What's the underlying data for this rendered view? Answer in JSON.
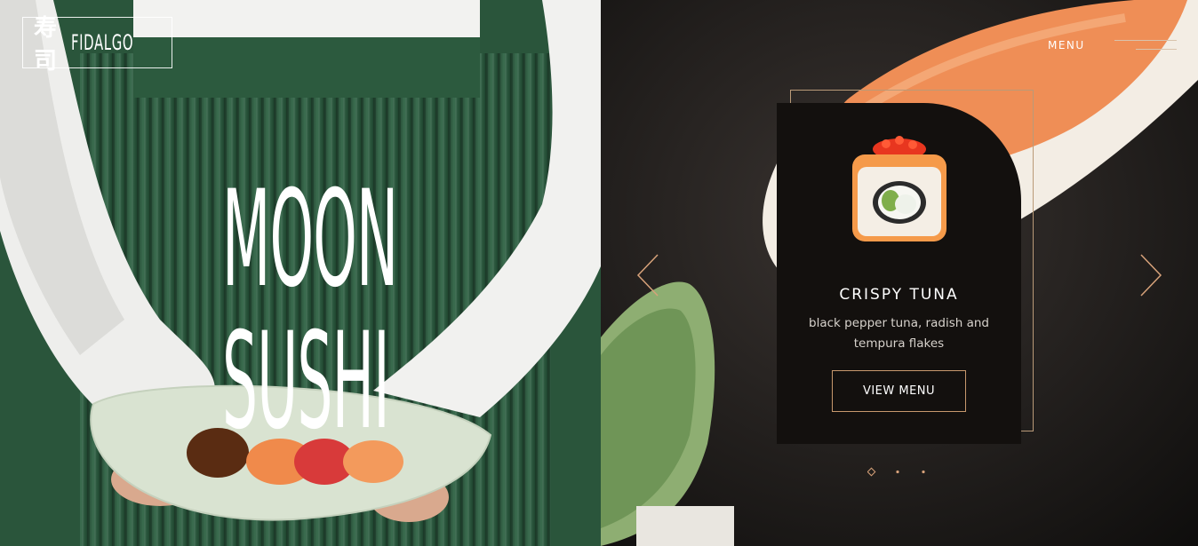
{
  "logo": {
    "kanji": "寿司",
    "brand": "FIDALGO"
  },
  "hero": {
    "line1": "MOON",
    "line2": "SUSHI"
  },
  "nav": {
    "menu_label": "MENU"
  },
  "card": {
    "title": "CRISPY TUNA",
    "description": "black pepper tuna, radish and tempura flakes",
    "button_label": "VIEW MENU"
  },
  "slider": {
    "slide_count": 3,
    "active_slide": 1
  },
  "colors": {
    "accent": "#c7986d",
    "card_bg": "#13100e",
    "skirt_green": "#2d5a3f",
    "text": "#ffffff"
  },
  "icons": {
    "prev": "chevron-left-icon",
    "next": "chevron-right-icon",
    "menu": "hamburger-icon",
    "dot_active": "diamond-icon"
  }
}
